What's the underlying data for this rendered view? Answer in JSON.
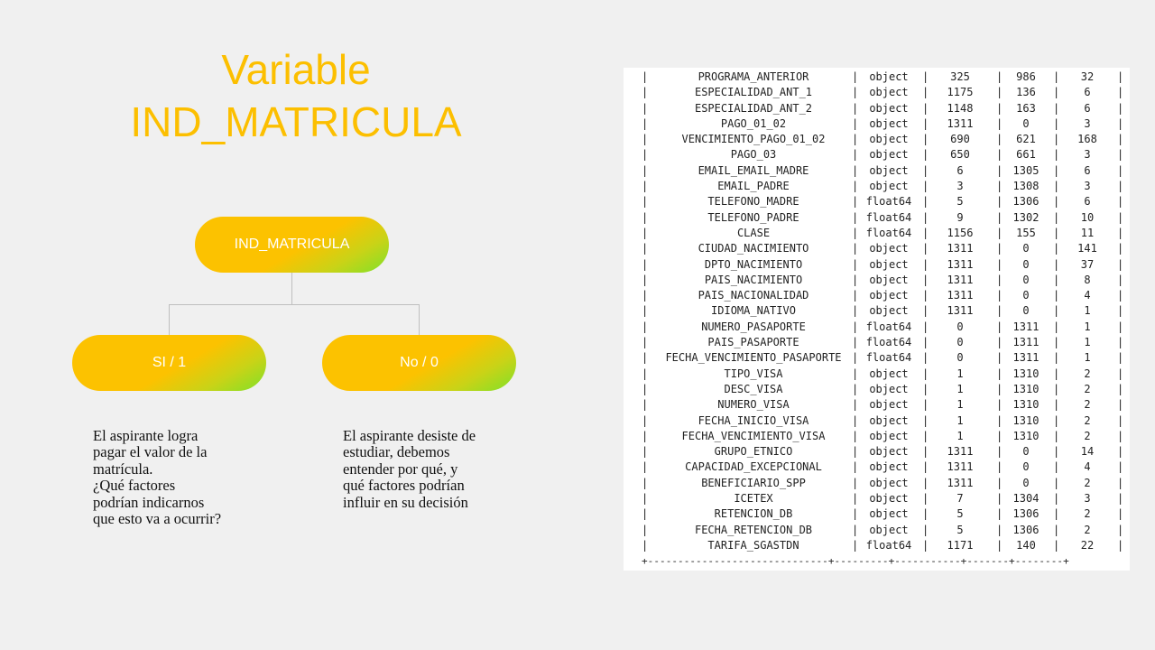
{
  "slide": {
    "title_line1": "Variable",
    "title_line2": "IND_MATRICULA",
    "tree": {
      "root_label": "IND_MATRICULA",
      "yes_label": "SI / 1",
      "no_label": "No / 0"
    },
    "yes_description": [
      "El aspirante logra",
      "pagar el valor de la",
      "matrícula.",
      "¿Qué factores",
      "podrían indicarnos",
      "que esto va a ocurrir?"
    ],
    "no_description": [
      "El aspirante desiste de",
      "estudiar, debemos",
      "entender por qué, y",
      "qué factores podrían",
      "influir en su decisión"
    ],
    "colors": {
      "title": "#fcbf00",
      "pill_start": "#fcc200",
      "pill_end": "#7fe129",
      "background": "#f0f0f0"
    }
  },
  "table": {
    "rows": [
      [
        "PROGRAMA_ANTERIOR",
        "object",
        "325",
        "986",
        "32"
      ],
      [
        "ESPECIALIDAD_ANT_1",
        "object",
        "1175",
        "136",
        "6"
      ],
      [
        "ESPECIALIDAD_ANT_2",
        "object",
        "1148",
        "163",
        "6"
      ],
      [
        "PAGO_01_02",
        "object",
        "1311",
        "0",
        "3"
      ],
      [
        "VENCIMIENTO_PAGO_01_02",
        "object",
        "690",
        "621",
        "168"
      ],
      [
        "PAGO_03",
        "object",
        "650",
        "661",
        "3"
      ],
      [
        "EMAIL_EMAIL_MADRE",
        "object",
        "6",
        "1305",
        "6"
      ],
      [
        "EMAIL_PADRE",
        "object",
        "3",
        "1308",
        "3"
      ],
      [
        "TELEFONO_MADRE",
        "float64",
        "5",
        "1306",
        "6"
      ],
      [
        "TELEFONO_PADRE",
        "float64",
        "9",
        "1302",
        "10"
      ],
      [
        "CLASE",
        "float64",
        "1156",
        "155",
        "11"
      ],
      [
        "CIUDAD_NACIMIENTO",
        "object",
        "1311",
        "0",
        "141"
      ],
      [
        "DPTO_NACIMIENTO",
        "object",
        "1311",
        "0",
        "37"
      ],
      [
        "PAIS_NACIMIENTO",
        "object",
        "1311",
        "0",
        "8"
      ],
      [
        "PAIS_NACIONALIDAD",
        "object",
        "1311",
        "0",
        "4"
      ],
      [
        "IDIOMA_NATIVO",
        "object",
        "1311",
        "0",
        "1"
      ],
      [
        "NUMERO_PASAPORTE",
        "float64",
        "0",
        "1311",
        "1"
      ],
      [
        "PAIS_PASAPORTE",
        "float64",
        "0",
        "1311",
        "1"
      ],
      [
        "FECHA_VENCIMIENTO_PASAPORTE",
        "float64",
        "0",
        "1311",
        "1"
      ],
      [
        "TIPO_VISA",
        "object",
        "1",
        "1310",
        "2"
      ],
      [
        "DESC_VISA",
        "object",
        "1",
        "1310",
        "2"
      ],
      [
        "NUMERO_VISA",
        "object",
        "1",
        "1310",
        "2"
      ],
      [
        "FECHA_INICIO_VISA",
        "object",
        "1",
        "1310",
        "2"
      ],
      [
        "FECHA_VENCIMIENTO_VISA",
        "object",
        "1",
        "1310",
        "2"
      ],
      [
        "GRUPO_ETNICO",
        "object",
        "1311",
        "0",
        "14"
      ],
      [
        "CAPACIDAD_EXCEPCIONAL",
        "object",
        "1311",
        "0",
        "4"
      ],
      [
        "BENEFICIARIO_SPP",
        "object",
        "1311",
        "0",
        "2"
      ],
      [
        "ICETEX",
        "object",
        "7",
        "1304",
        "3"
      ],
      [
        "RETENCION_DB",
        "object",
        "5",
        "1306",
        "2"
      ],
      [
        "FECHA_RETENCION_DB",
        "object",
        "5",
        "1306",
        "2"
      ],
      [
        "TARIFA_SGASTDN",
        "float64",
        "1171",
        "140",
        "22"
      ]
    ],
    "bottom_border": "+------------------------------+---------+-----------+-------+--------+"
  }
}
